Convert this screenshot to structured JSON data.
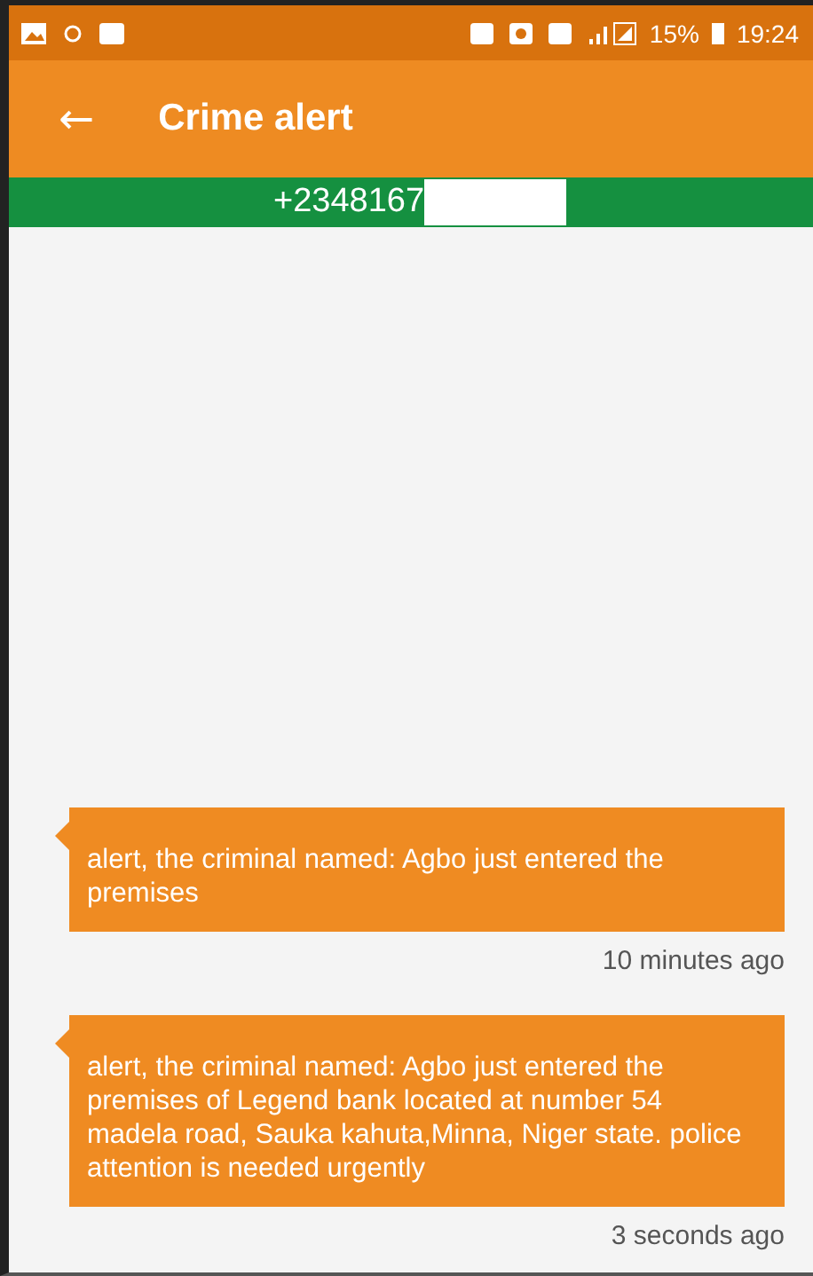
{
  "status_bar": {
    "battery": "15%",
    "time": "19:24"
  },
  "app_bar": {
    "back": "←",
    "title": "Crime alert"
  },
  "contact": {
    "number": "+2348167"
  },
  "messages": [
    {
      "text": "alert, the criminal named: Agbo just entered the premises",
      "time": "10 minutes ago"
    },
    {
      "text": "alert, the criminal named: Agbo just entered the premises of Legend bank located at number 54 madela road, Sauka kahuta,Minna, Niger state. police attention is needed urgently",
      "time": "3 seconds ago"
    }
  ]
}
